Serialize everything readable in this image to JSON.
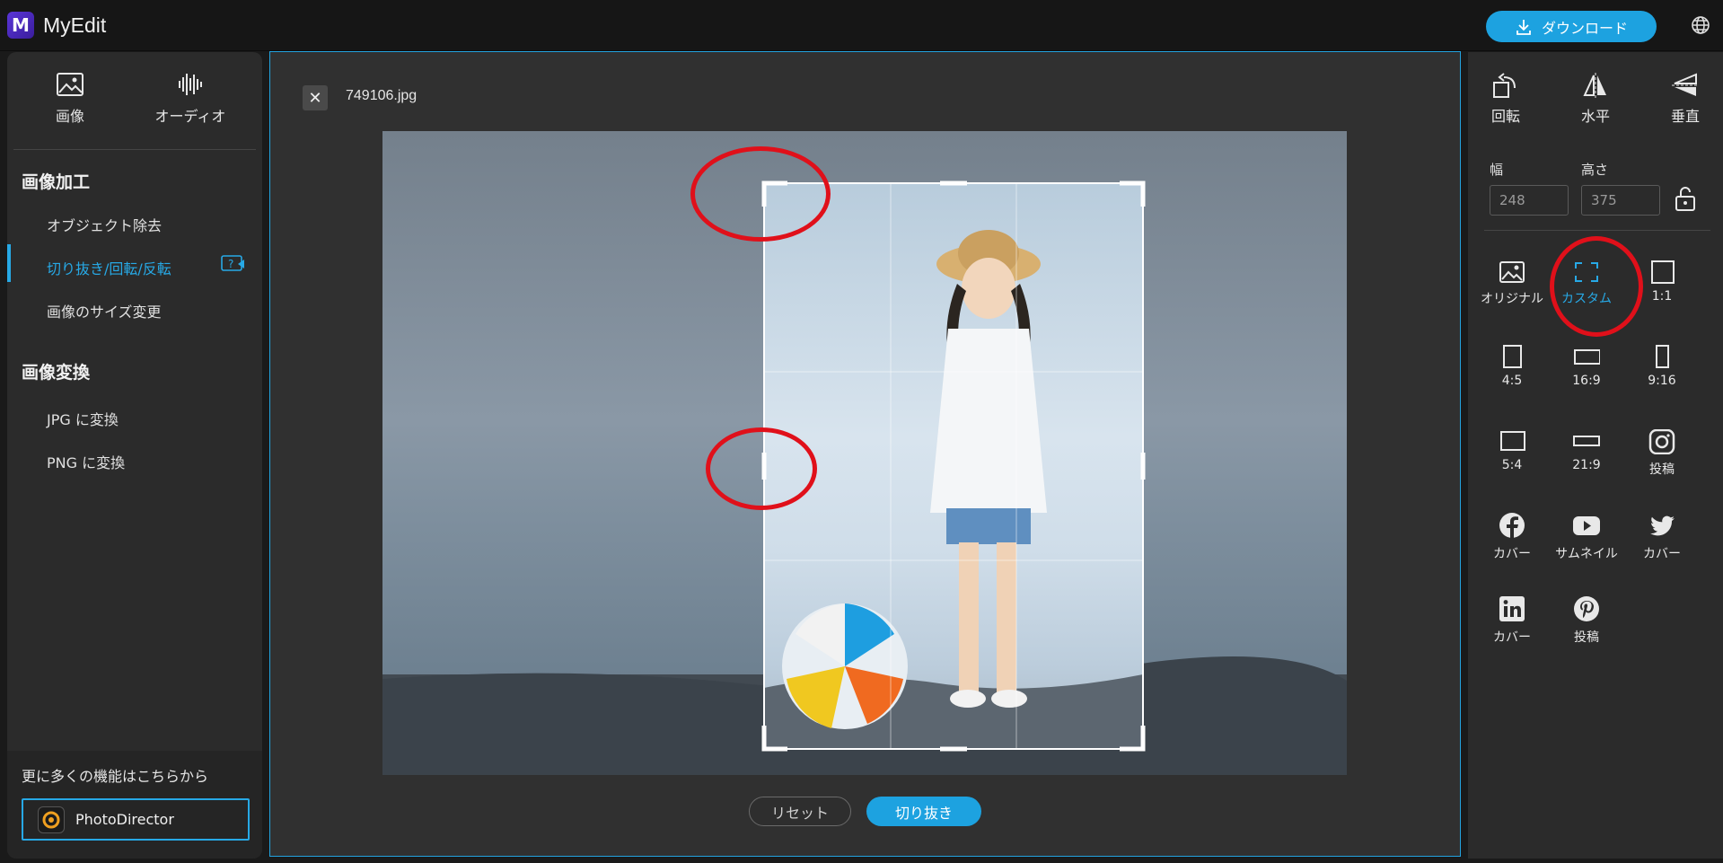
{
  "app": {
    "logo_letter": "M",
    "title": "MyEdit",
    "download_label": "ダウンロード"
  },
  "left": {
    "tabs": [
      {
        "label": "画像",
        "icon": "image-icon"
      },
      {
        "label": "オーディオ",
        "icon": "audio-wave-icon"
      }
    ],
    "sections": [
      {
        "title": "画像加工",
        "items": [
          "オブジェクト除去",
          "切り抜き/回転/反転",
          "画像のサイズ変更"
        ]
      },
      {
        "title": "画像変換",
        "items": [
          "JPG に変換",
          "PNG に変換"
        ]
      }
    ],
    "active_item": "切り抜き/回転/反転",
    "more_text": "更に多くの機能はこちらから",
    "photodirector_label": "PhotoDirector"
  },
  "editor": {
    "filename": "749106.jpg",
    "reset_label": "リセット",
    "crop_label": "切り抜き"
  },
  "right": {
    "transform": [
      {
        "label": "回転",
        "icon": "rotate-icon"
      },
      {
        "label": "水平",
        "icon": "flip-horizontal-icon"
      },
      {
        "label": "垂直",
        "icon": "flip-vertical-icon"
      }
    ],
    "width_label": "幅",
    "width_value": "248",
    "height_label": "高さ",
    "height_value": "375",
    "ratios": [
      {
        "label": "オリジナル",
        "icon": "original-image-icon"
      },
      {
        "label": "カスタム",
        "icon": "custom-frame-icon",
        "active": true
      },
      {
        "label": "1:1",
        "icon": "square-icon"
      },
      {
        "label": "4:5",
        "icon": "portrait-4-5-icon"
      },
      {
        "label": "16:9",
        "icon": "landscape-16-9-icon"
      },
      {
        "label": "9:16",
        "icon": "portrait-9-16-icon"
      },
      {
        "label": "5:4",
        "icon": "landscape-5-4-icon"
      },
      {
        "label": "21:9",
        "icon": "landscape-21-9-icon"
      },
      {
        "label": "投稿",
        "icon": "instagram-icon"
      },
      {
        "label": "カバー",
        "icon": "facebook-icon"
      },
      {
        "label": "サムネイル",
        "icon": "youtube-icon"
      },
      {
        "label": "カバー",
        "icon": "twitter-icon"
      },
      {
        "label": "カバー",
        "icon": "linkedin-icon"
      },
      {
        "label": "投稿",
        "icon": "pinterest-icon"
      }
    ]
  },
  "colors": {
    "accent": "#1da2e0",
    "annotation": "#e0101a"
  }
}
